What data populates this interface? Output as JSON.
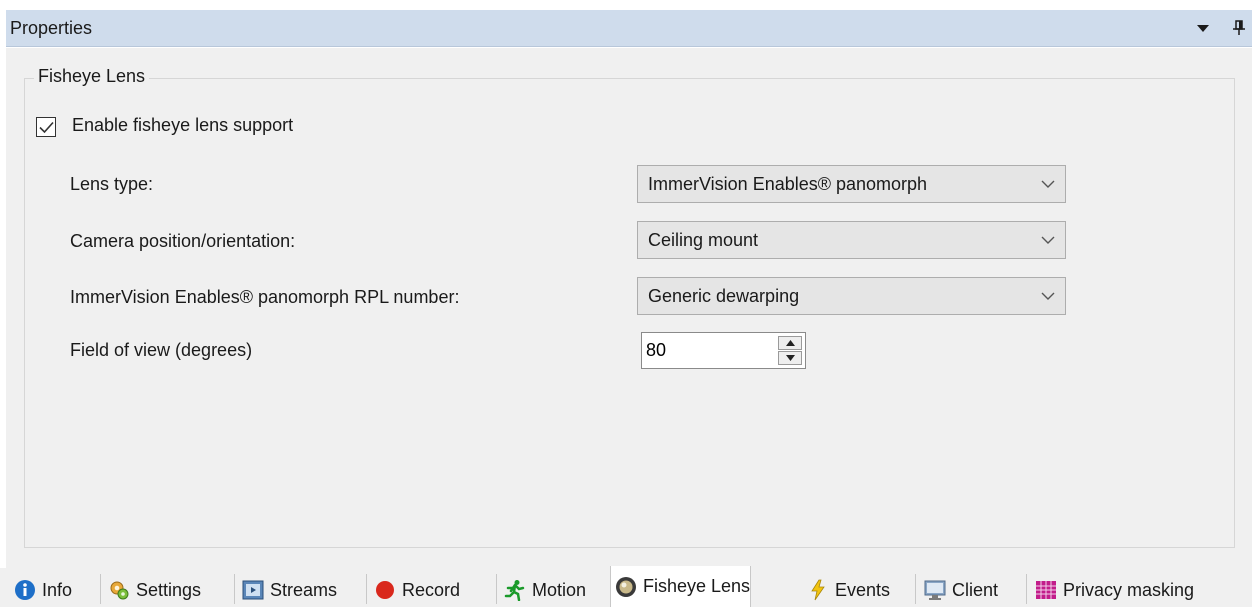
{
  "header": {
    "title": "Properties"
  },
  "group": {
    "title": "Fisheye Lens"
  },
  "enable": {
    "label": "Enable fisheye lens support",
    "checked": true
  },
  "rows": [
    {
      "label": "Lens type:",
      "value": "ImmerVision Enables® panomorph"
    },
    {
      "label": "Camera position/orientation:",
      "value": "Ceiling mount"
    },
    {
      "label": "ImmerVision Enables® panomorph RPL number:",
      "value": "Generic dewarping"
    }
  ],
  "fov": {
    "label": "Field of view (degrees)",
    "value": "80"
  },
  "tabs": [
    {
      "label": "Info",
      "icon": "info-icon"
    },
    {
      "label": "Settings",
      "icon": "settings-icon"
    },
    {
      "label": "Streams",
      "icon": "streams-icon"
    },
    {
      "label": "Record",
      "icon": "record-icon"
    },
    {
      "label": "Motion",
      "icon": "motion-icon"
    },
    {
      "label": "Fisheye Lens",
      "icon": "fisheye-lens-icon",
      "active": true
    },
    {
      "label": "Events",
      "icon": "events-icon"
    },
    {
      "label": "Client",
      "icon": "client-icon"
    },
    {
      "label": "Privacy masking",
      "icon": "privacy-masking-icon"
    }
  ],
  "colors": {
    "header_bg": "#cfdcec",
    "panel_bg": "#f0f0f0",
    "combo_bg": "#e5e5e5"
  }
}
